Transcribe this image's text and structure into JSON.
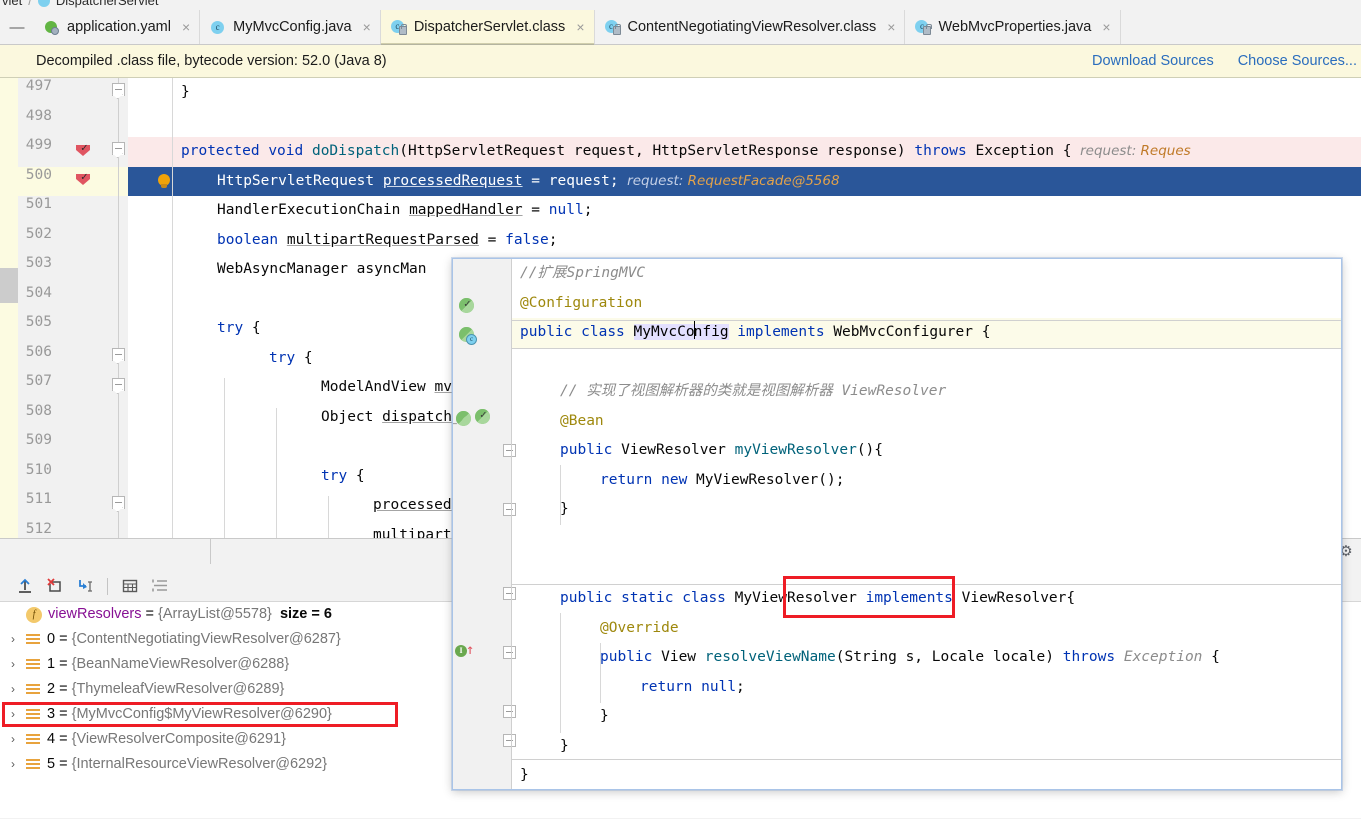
{
  "breadcrumb": {
    "trail_text": "vlet",
    "separator": "/",
    "class_name": "DispatcherServlet"
  },
  "tabs": [
    {
      "label": "application.yaml",
      "icon": "yaml-icon",
      "close": "×",
      "active": false,
      "kind": "yaml"
    },
    {
      "label": "MyMvcConfig.java",
      "icon": "java-class-icon",
      "close": "×",
      "active": false,
      "kind": "java"
    },
    {
      "label": "DispatcherServlet.class",
      "icon": "java-compiled-class-icon",
      "close": "×",
      "active": true,
      "kind": "class"
    },
    {
      "label": "ContentNegotiatingViewResolver.class",
      "icon": "java-compiled-class-icon",
      "close": "×",
      "active": false,
      "kind": "class"
    },
    {
      "label": "WebMvcProperties.java",
      "icon": "java-class-icon",
      "close": "×",
      "active": false,
      "kind": "class"
    }
  ],
  "notification": {
    "message": "Decompiled .class file, bytecode version: 52.0 (Java 8)",
    "download_sources": "Download Sources",
    "choose_sources": "Choose Sources..."
  },
  "editor": {
    "line_numbers": [
      "497",
      "498",
      "499",
      "500",
      "501",
      "502",
      "503",
      "504",
      "505",
      "506",
      "507",
      "508",
      "509",
      "510",
      "511",
      "512"
    ],
    "current_line": "500",
    "breakpoint_lines": [
      "499",
      "500"
    ],
    "lines": [
      {
        "n": "497",
        "code": "}"
      },
      {
        "n": "498",
        "code": ""
      },
      {
        "n": "499",
        "code": "protected void doDispatch(HttpServletRequest request, HttpServletResponse response) throws Exception {",
        "hint_label": "request:",
        "hint_value": "Reques"
      },
      {
        "n": "500",
        "code": "HttpServletRequest processedRequest = request;",
        "hint_label": "request:",
        "hint_value": "RequestFacade@5568"
      },
      {
        "n": "501",
        "code": "HandlerExecutionChain mappedHandler = null;"
      },
      {
        "n": "502",
        "code": "boolean multipartRequestParsed = false;"
      },
      {
        "n": "503",
        "code": "WebAsyncManager asyncMan"
      },
      {
        "n": "504",
        "code": ""
      },
      {
        "n": "505",
        "code": "try {"
      },
      {
        "n": "506",
        "code": "try {"
      },
      {
        "n": "507",
        "code": "ModelAndView mv"
      },
      {
        "n": "508",
        "code": "Object dispatchE"
      },
      {
        "n": "509",
        "code": ""
      },
      {
        "n": "510",
        "code": "try {"
      },
      {
        "n": "511",
        "code": "processedReq"
      },
      {
        "n": "512",
        "code": "multipartReq"
      }
    ]
  },
  "popup": {
    "lines": [
      {
        "text": "//扩展SpringMVC",
        "kind": "comment"
      },
      {
        "text": "@Configuration",
        "kind": "annotation"
      },
      {
        "text": "public class MyMvcConfig implements WebMvcConfigurer {",
        "kind": "decl",
        "current": true
      },
      {
        "text": "",
        "kind": "blank"
      },
      {
        "text": "// 实现了视图解析器的类就是视图解析器 ViewResolver",
        "kind": "comment"
      },
      {
        "text": "@Bean",
        "kind": "annotation"
      },
      {
        "text": "public ViewResolver myViewResolver(){",
        "kind": "decl"
      },
      {
        "text": "return new MyViewResolver();",
        "kind": "stmt"
      },
      {
        "text": "}",
        "kind": "brace"
      },
      {
        "text": "",
        "kind": "blank"
      },
      {
        "text": "public static class MyViewResolver implements ViewResolver{",
        "kind": "decl",
        "highlight": true
      },
      {
        "text": "@Override",
        "kind": "annotation"
      },
      {
        "text": "public View resolveViewName(String s, Locale locale) throws Exception {",
        "kind": "decl"
      },
      {
        "text": "return null;",
        "kind": "stmt"
      },
      {
        "text": "}",
        "kind": "brace"
      },
      {
        "text": "}",
        "kind": "brace"
      },
      {
        "text": "}",
        "kind": "brace"
      }
    ],
    "class_name_token": "MyMvcConfig",
    "highlighted_token": "MyViewResolver"
  },
  "debug_toolbar": {
    "buttons": [
      {
        "name": "evaluate-expression-icon",
        "title": "Evaluate Expression"
      },
      {
        "name": "mute-breakpoints-icon",
        "title": "Mute Breakpoints"
      },
      {
        "name": "jump-to-source-icon",
        "title": "Jump To Source"
      },
      {
        "name": "view-as-table-icon",
        "title": "View as Table"
      },
      {
        "name": "sort-values-icon",
        "title": "Sort Values"
      }
    ]
  },
  "variables": {
    "root": {
      "name": "viewResolvers",
      "eq": "=",
      "value": "{ArrayList@5578}",
      "size_label": "size = 6",
      "icon": "field-icon"
    },
    "items": [
      {
        "index": "0",
        "eq": "=",
        "value": "{ContentNegotiatingViewResolver@6287}",
        "highlighted": false
      },
      {
        "index": "1",
        "eq": "=",
        "value": "{BeanNameViewResolver@6288}",
        "highlighted": false
      },
      {
        "index": "2",
        "eq": "=",
        "value": "{ThymeleafViewResolver@6289}",
        "highlighted": false
      },
      {
        "index": "3",
        "eq": "=",
        "value": "{MyMvcConfig$MyViewResolver@6290}",
        "highlighted": true
      },
      {
        "index": "4",
        "eq": "=",
        "value": "{ViewResolverComposite@6291}",
        "highlighted": false
      },
      {
        "index": "5",
        "eq": "=",
        "value": "{InternalResourceViewResolver@6292}",
        "highlighted": false
      }
    ],
    "expand_chevron": "›"
  },
  "colors": {
    "tab_active_bg": "#fbf8de",
    "notification_bg": "#fbf8de",
    "link": "#2a6dbd",
    "selection_bg": "#2a5699",
    "error_line_bg": "#fbe9e9",
    "keyword": "#0033b3",
    "method": "#00627a",
    "annotation": "#9e880d",
    "comment": "#8c8c8c",
    "inline_hint_value": "#c07a28",
    "red_highlight_box": "#ee1c25",
    "breakpoint": "#e05561"
  },
  "gear_icon": "⚙"
}
